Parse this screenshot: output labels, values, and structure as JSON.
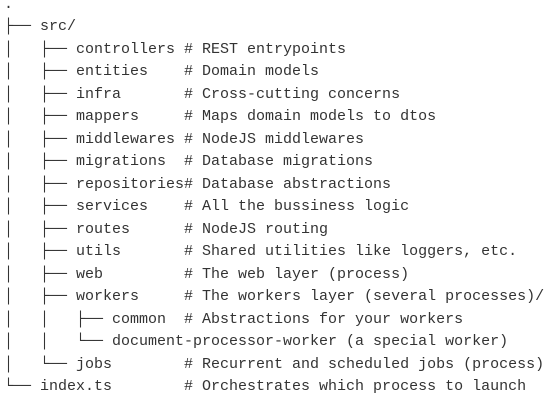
{
  "tree": {
    "lines": [
      ".",
      "├── src/",
      "│   ├── controllers # REST entrypoints",
      "│   ├── entities    # Domain models",
      "│   ├── infra       # Cross-cutting concerns",
      "│   ├── mappers     # Maps domain models to dtos",
      "│   ├── middlewares # NodeJS middlewares",
      "│   ├── migrations  # Database migrations",
      "│   ├── repositories# Database abstractions",
      "│   ├── services    # All the bussiness logic",
      "│   ├── routes      # NodeJS routing",
      "│   ├── utils       # Shared utilities like loggers, etc.",
      "│   ├── web         # The web layer (process)",
      "│   ├── workers     # The workers layer (several processes)/",
      "│   │   ├── common  # Abstractions for your workers",
      "│   │   └── document-processor-worker (a special worker)",
      "│   └── jobs        # Recurrent and scheduled jobs (process)",
      "└── index.ts        # Orchestrates which process to launch"
    ]
  }
}
